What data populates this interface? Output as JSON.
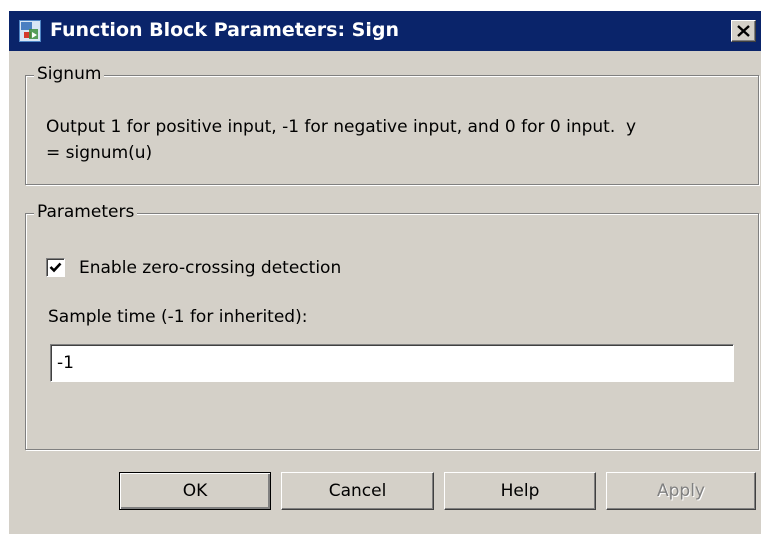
{
  "window": {
    "title": "Function Block Parameters: Sign",
    "icons": {
      "app": "simulink-block-icon",
      "close": "close-icon"
    }
  },
  "signum_group": {
    "legend": "Signum",
    "description_line1": "Output 1 for positive input, -1 for negative input, and 0 for 0 input.  y",
    "description_line2": "= signum(u)"
  },
  "parameters_group": {
    "legend": "Parameters",
    "zero_crossing": {
      "label": "Enable zero-crossing detection",
      "checked": true
    },
    "sample_time": {
      "label": "Sample time (-1 for inherited):",
      "value": "-1"
    }
  },
  "buttons": {
    "ok": "OK",
    "cancel": "Cancel",
    "help": "Help",
    "apply": "Apply",
    "apply_enabled": false
  },
  "colors": {
    "title_bar": "#0a246a",
    "face": "#d4d0c8",
    "disabled_text": "#808080"
  }
}
